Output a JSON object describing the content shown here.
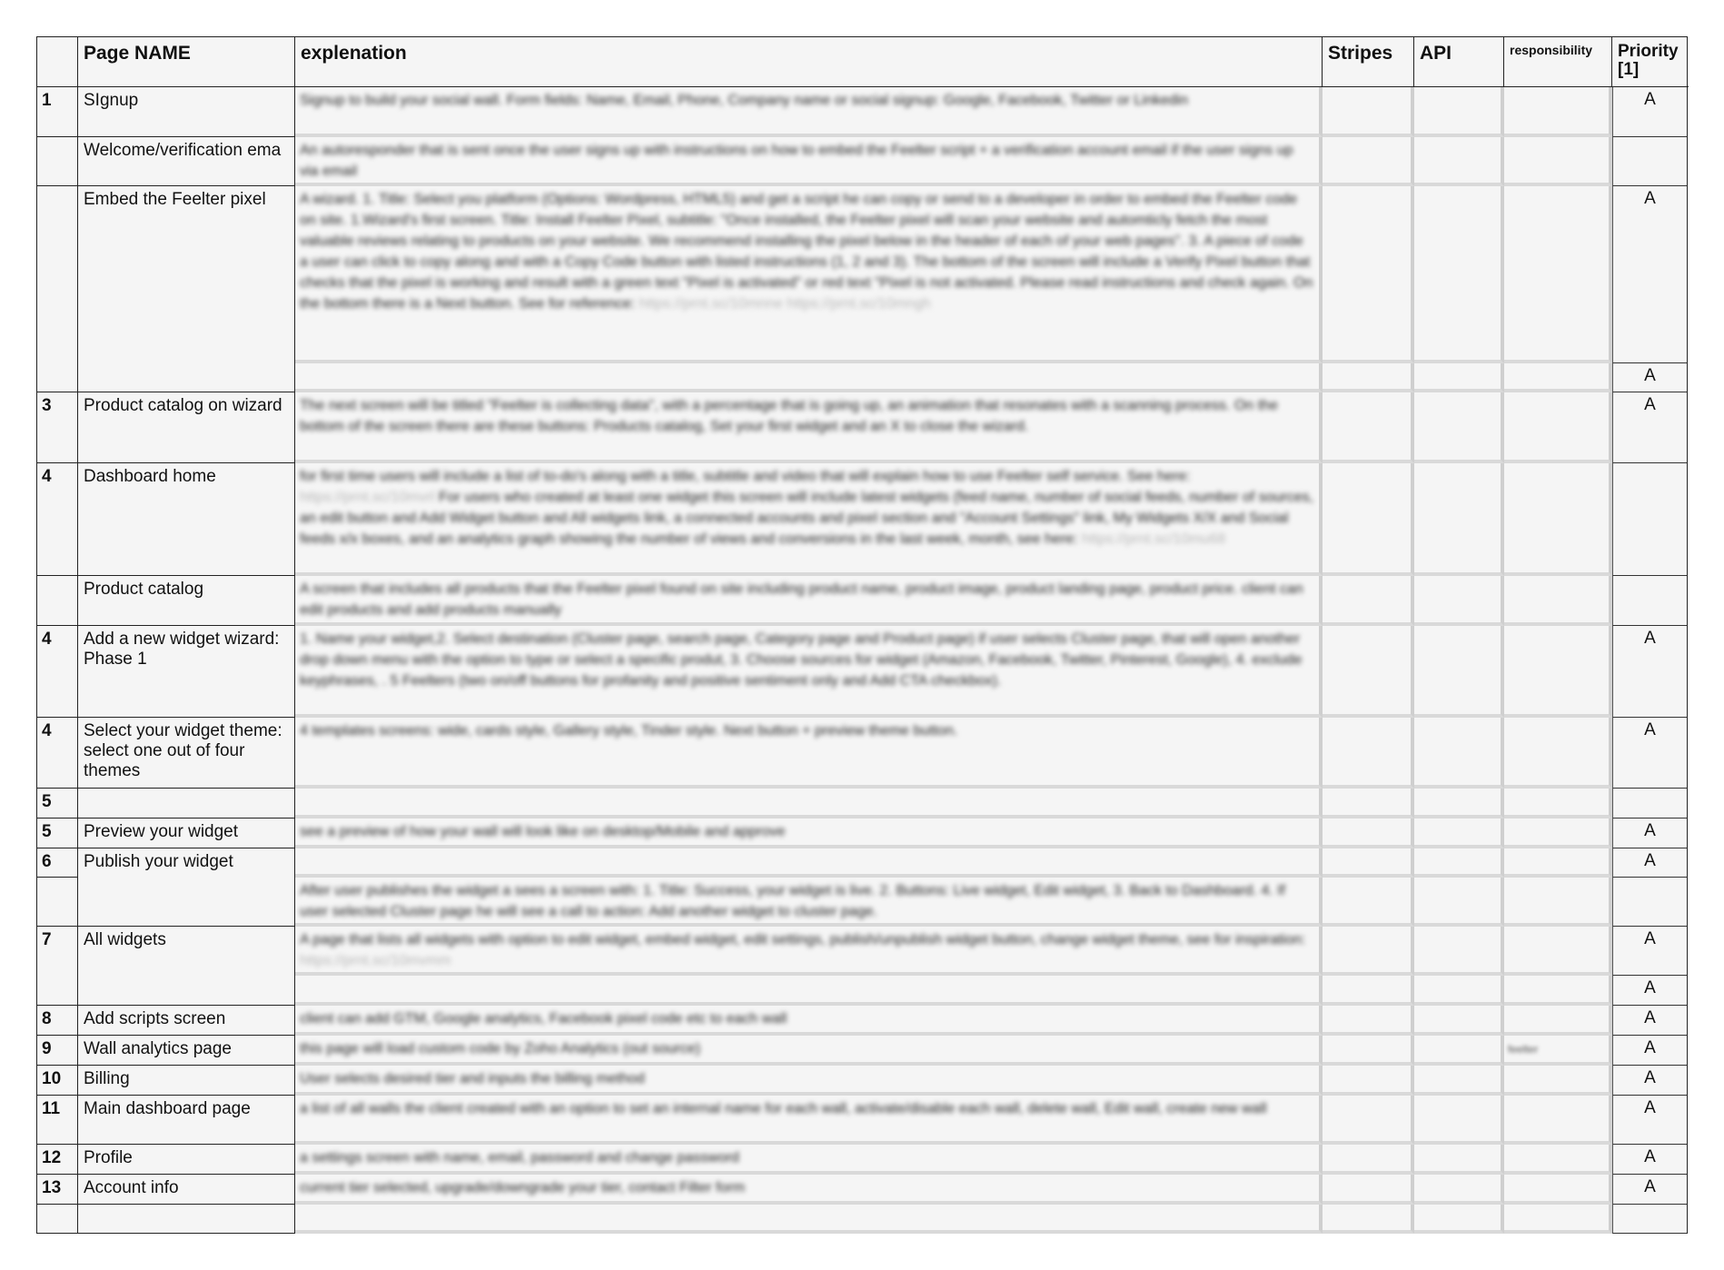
{
  "headers": {
    "num": "",
    "page_name": "Page NAME",
    "explanation": "explenation",
    "stripes": "Stripes",
    "api": "API",
    "responsibility": "responsibility",
    "priority": "Priority [1]"
  },
  "rows": [
    {
      "num": "1",
      "name": "SIgnup",
      "explanation": "Signup to build your social wall. Form fields: Name, Email, Phone, Company name or social signup: Google, Facebook, Twitter or Linkedin",
      "responsibility": "",
      "priority": "A"
    },
    {
      "num": "",
      "name": "Welcome/verification ema",
      "explanation": "An autoresponder that is sent once the user signs up with instructions on how to embed the Feelter script + a verification account email if the user signs up via email",
      "responsibility": "",
      "priority": ""
    },
    {
      "num": "",
      "name": "Embed the Feelter pixel",
      "explanation": "A wizard. 1. Title: Select you platform (Options: Wordpress, HTML5) and get a script he can copy or send to a developer in order to embed the Feelter code on site. 1.Wizard's first screen. Title: Install Feelter Pixel, subtitle: \"Once installed, the Feelter pixel will scan your website and automticly fetch the most valuable reviews relating to products on your website. We recommend installing the pixel below in the header of each of your web pages\". 3. A piece of code a user can click to copy along and with a Copy Code button with listed instructions (1, 2 and 3). The bottom of the screen will include a Verify Pixel button that checks that the pixel is working and result with a green text \"Pixel is activated\" or red text \"Pixel is not activated. Please read instructions and check again. On the bottom there is a Next button. See for reference:",
      "link": "https://prnt.sc/10mnne https://prnt.sc/10mngh",
      "responsibility": "",
      "priority": "A",
      "sub_priority": "A"
    },
    {
      "num": "3",
      "name": "Product catalog on wizard",
      "explanation": "The next screen will be titled \"Feelter is collecting data\", with a percentage that is going up, an animation that resonates with a scanning process. On the bottom of the screen there are these buttons: Products catalog, Set your first widget and an X to close the wizard.",
      "responsibility": "",
      "priority": "A"
    },
    {
      "num": "4",
      "name": "Dashboard home",
      "explanation": "for first time users will include a list of to-do's along with a title, subtitle and video that will explain how to use Feelter self service. See here:",
      "link": "https://prnt.sc/10mvrl",
      "explanation2": "For users who created at least one widget this screen will include latest widgets (feed name, number of social feeds, number of sources, an edit button and Add Widget button and All widgets link, a connected accounts and pixel section and \"Account Settings\" link, My Widgets X/X and Social feeds x/x boxes, and an analytics graph showing the number of views and conversions in the last week, month, see here:",
      "link2": "https://prnt.sc/10mu68",
      "responsibility": "",
      "priority": ""
    },
    {
      "num": "",
      "name": "Product catalog",
      "explanation": "A screen that includes all products that the Feelter pixel found on site including product name, product image, product landing page, product price. client can edit products and add products manually",
      "responsibility": "",
      "priority": ""
    },
    {
      "num": "4",
      "name": "Add a new widget wizard: Phase 1",
      "explanation": "1. Name your widget,2. Select destination (Cluster page, search page, Category page and Product page) if user selects Cluster page, that will open another drop down menu with the option to type or select a specific produt, 3. Choose sources for widget (Amazon, Facebook, Twitter, Pinterest, Google), 4. exclude keyphrases, . 5 Feelters (two on/off buttons for profanity and positive sentiment only and Add CTA checkbox).",
      "responsibility": "",
      "priority": "A"
    },
    {
      "num": "4",
      "name": "Select your widget theme: select one out of four themes",
      "explanation": "4 templates screens: wide, cards style, Gallery style, Tinder style. Next button + preview theme button.",
      "responsibility": "",
      "priority": "A"
    },
    {
      "num": "5",
      "name": "",
      "explanation": "",
      "responsibility": "",
      "priority": ""
    },
    {
      "num": "5",
      "name": "Preview your widget",
      "explanation": "see a preview of how your wall will look like on desktop/Mobile and approve",
      "responsibility": "",
      "priority": "A"
    },
    {
      "num": "6",
      "name": "Publish your widget",
      "explanation": "",
      "sub_explanation": "After user publishes the widget a sees a screen with: 1. Title: Success, your widget is live. 2. Buttons: Live widget, Edit widget, 3. Back to Dashboard. 4. If user selected Cluster page he will see a call to action: Add another widget to cluster page.",
      "responsibility": "",
      "priority": "A",
      "sub_priority": ""
    },
    {
      "num": "7",
      "name": "All widgets",
      "explanation": "A page that lists all widgets with option to edit widget, embed widget, edit settings, publish/unpublish widget button, change widget theme, see for inspiration:",
      "link": "https://prnt.sc/10mvmm",
      "responsibility": "",
      "priority": "A",
      "sub_priority": "A"
    },
    {
      "num": "8",
      "name": "Add scripts screen",
      "explanation": "client can add GTM, Google analytics, Facebook pixel code etc to each wall",
      "responsibility": "",
      "priority": "A"
    },
    {
      "num": "9",
      "name": "Wall analytics page",
      "explanation": "this page will load custom code by Zoho Analytics (out source)",
      "responsibility": "feelter",
      "priority": "A"
    },
    {
      "num": "10",
      "name": "Billing",
      "explanation": "User selects desired tier and inputs the billing method",
      "responsibility": "",
      "priority": "A"
    },
    {
      "num": "11",
      "name": "Main dashboard page",
      "explanation": "a list of all walls the client created with an option to set an internal name for each wall, activate/disable each wall, delete wall, Edit wall, create new wall",
      "responsibility": "",
      "priority": "A"
    },
    {
      "num": "12",
      "name": "Profile",
      "explanation": "a settings screen with name, email, password and change password",
      "responsibility": "",
      "priority": "A"
    },
    {
      "num": "13",
      "name": "Account info",
      "explanation": "current tier selected, upgrade/downgrade your tier, contact Filter form",
      "responsibility": "",
      "priority": "A"
    },
    {
      "num": "",
      "name": "",
      "explanation": "",
      "responsibility": "",
      "priority": ""
    }
  ]
}
